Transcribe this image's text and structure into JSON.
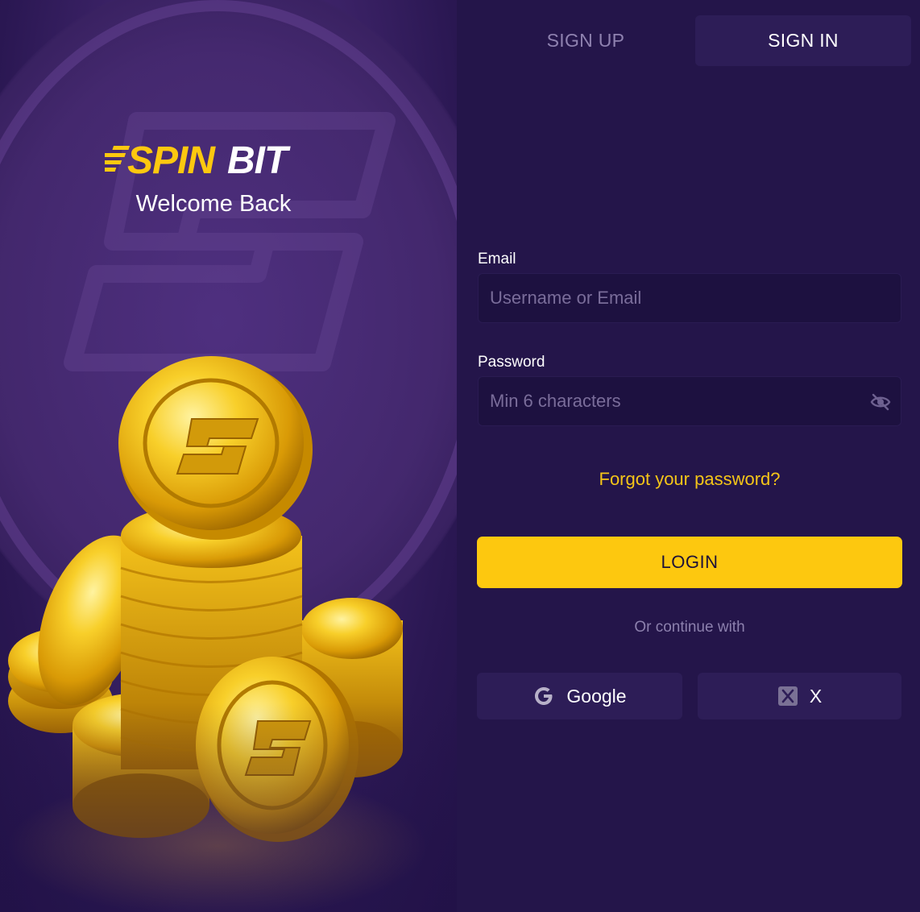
{
  "brand": {
    "logo_text": "SPINBIT",
    "welcome": "Welcome Back"
  },
  "tabs": {
    "sign_up": "SIGN UP",
    "sign_in": "SIGN IN",
    "active": "sign_in"
  },
  "form": {
    "email": {
      "label": "Email",
      "placeholder": "Username or Email",
      "value": ""
    },
    "password": {
      "label": "Password",
      "placeholder": "Min 6 characters",
      "value": "",
      "toggle_icon": "eye-off-icon"
    },
    "forgot": "Forgot your password?",
    "login": "LOGIN",
    "or_continue": "Or continue with"
  },
  "social": {
    "google": {
      "label": "Google",
      "icon": "google-icon"
    },
    "x": {
      "label": "X",
      "icon": "x-icon"
    }
  },
  "colors": {
    "accent": "#fdc80f",
    "link": "#f5c518",
    "panel_bg": "#24154a",
    "tile_bg": "#2d1d57",
    "field_bg": "#1d1140"
  }
}
